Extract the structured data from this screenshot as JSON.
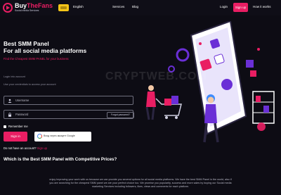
{
  "header": {
    "logo_name_a": "Buy",
    "logo_name_b": "TheFans",
    "logo_tagline": "Social media Services",
    "language": "English",
    "nav": [
      "Services",
      "Blog"
    ],
    "login": "Login",
    "signup": "Sign up",
    "how_it_works": "How it works"
  },
  "hero": {
    "title_line1": "Best SMM Panel",
    "title_line2": "For all social media platforms",
    "subtitle": "Find the Cheapest SMM PANEL for your business"
  },
  "form": {
    "label_login": "Login into account",
    "label_hint": "Use your credentials to access your account",
    "username_placeholder": "Username",
    "password_placeholder": "Password",
    "forgot": "Forgot password?",
    "remember": "Remember me",
    "signin": "Sign in",
    "google": "Вход через аккаунт Google",
    "no_account": "Do not have an account?",
    "signup_link": "Sign up"
  },
  "section": {
    "title": "Which is the Best SMM Panel with Competitive Prices?",
    "para_line1": "enjoy Improving your work with us because we can provide you several options for all social media platforms. We have the best SMM Panel in the world, also if",
    "para_line2": "you are searching for the cheapest SMM panel we are your perfect choice too. We promise you popularity, success and more sales by buying our Social media",
    "para_line3": "marketing Services including followers, likes, views and comments for each platform."
  },
  "watermark": "CRYPTWEB.COM",
  "colors": {
    "background": "#0d0c14",
    "accent": "#e91e63",
    "purple": "#6a2fd6",
    "text": "#ffffff"
  },
  "icons": [
    "logo-icon",
    "flag-icon",
    "user-icon",
    "lock-icon",
    "google-icon"
  ]
}
